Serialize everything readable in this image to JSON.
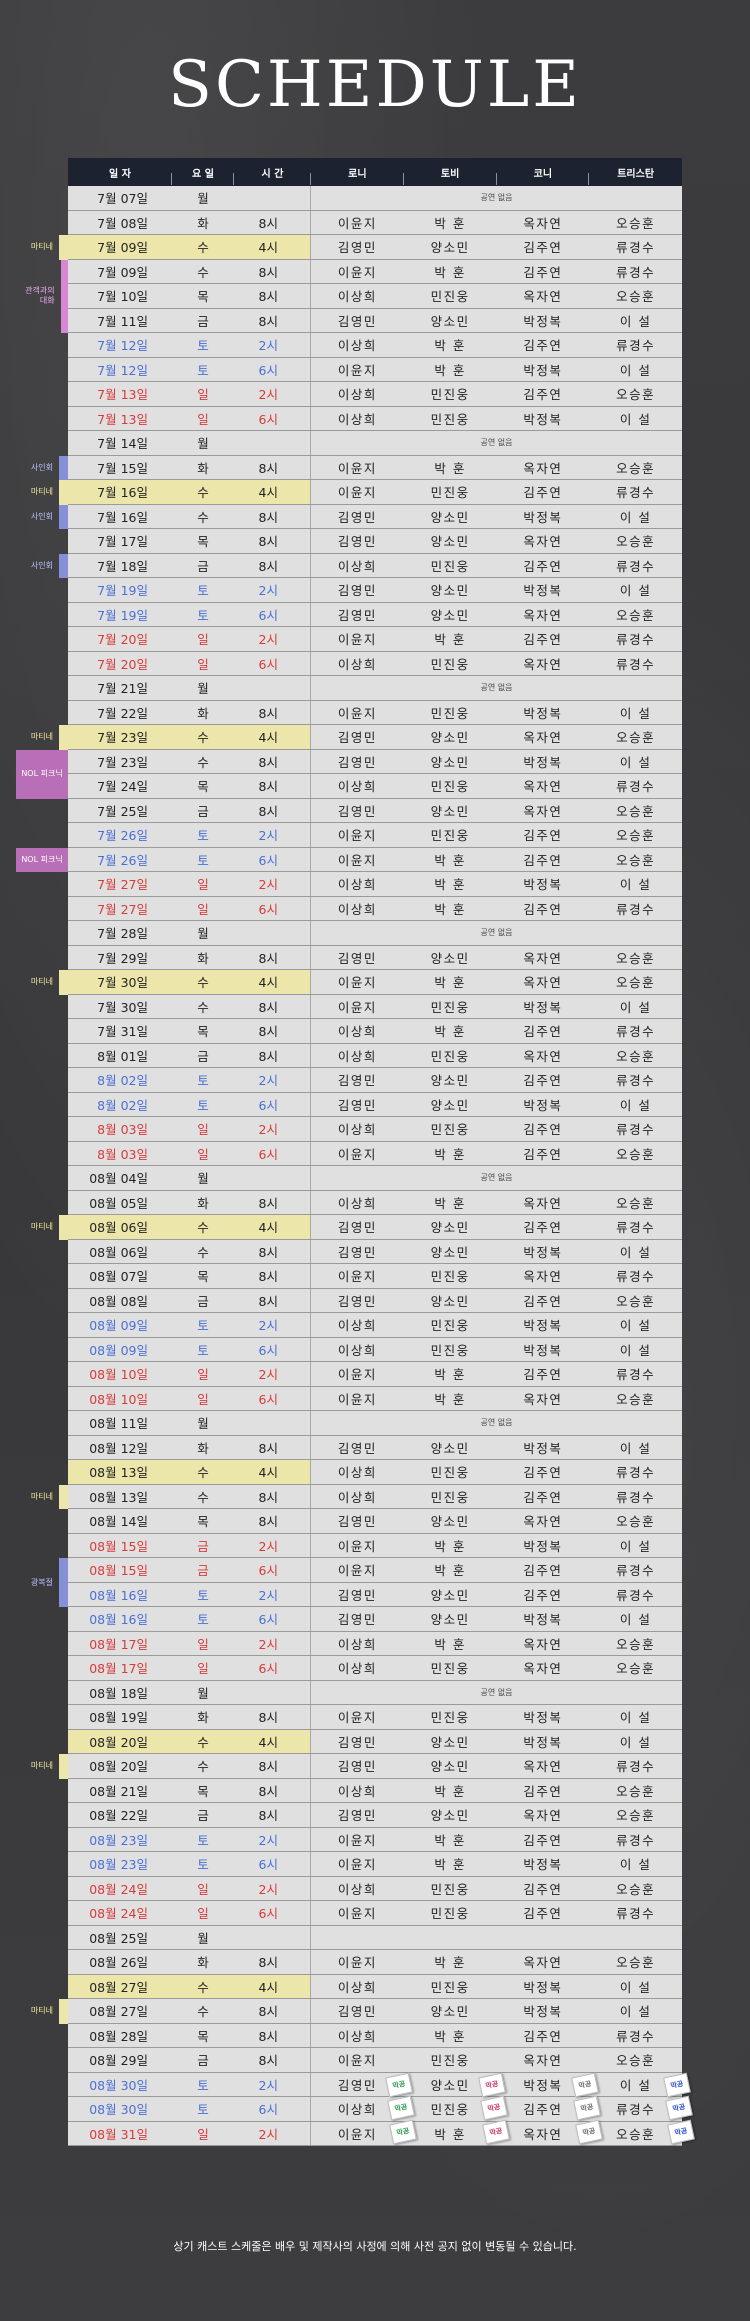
{
  "title": "SCHEDULE",
  "headers": [
    "일 자",
    "요 일",
    "시 간",
    "로니",
    "토비",
    "코니",
    "트리스탄"
  ],
  "no_show": "공연 없음",
  "rows": [
    {
      "date": "7월 07일",
      "day": "월",
      "time": "",
      "cast": [],
      "type": "off"
    },
    {
      "date": "7월 08일",
      "day": "화",
      "time": "8시",
      "cast": [
        "이윤지",
        "박 훈",
        "옥자연",
        "오승훈"
      ]
    },
    {
      "date": "7월 09일",
      "day": "수",
      "time": "4시",
      "cast": [
        "김영민",
        "양소민",
        "김주연",
        "류경수"
      ],
      "hl": true
    },
    {
      "date": "7월 09일",
      "day": "수",
      "time": "8시",
      "cast": [
        "이윤지",
        "박 훈",
        "김주연",
        "류경수"
      ]
    },
    {
      "date": "7월 10일",
      "day": "목",
      "time": "8시",
      "cast": [
        "이상희",
        "민진웅",
        "옥자연",
        "오승훈"
      ]
    },
    {
      "date": "7월 11일",
      "day": "금",
      "time": "8시",
      "cast": [
        "김영민",
        "양소민",
        "박정복",
        "이 설"
      ]
    },
    {
      "date": "7월 12일",
      "day": "토",
      "time": "2시",
      "cast": [
        "이상희",
        "박 훈",
        "김주연",
        "류경수"
      ],
      "type": "sat"
    },
    {
      "date": "7월 12일",
      "day": "토",
      "time": "6시",
      "cast": [
        "이윤지",
        "박 훈",
        "박정복",
        "이 설"
      ],
      "type": "sat"
    },
    {
      "date": "7월 13일",
      "day": "일",
      "time": "2시",
      "cast": [
        "이상희",
        "민진웅",
        "김주연",
        "오승훈"
      ],
      "type": "sun"
    },
    {
      "date": "7월 13일",
      "day": "일",
      "time": "6시",
      "cast": [
        "이상희",
        "민진웅",
        "박정복",
        "이 설"
      ],
      "type": "sun"
    },
    {
      "date": "7월 14일",
      "day": "월",
      "time": "",
      "cast": [],
      "type": "off"
    },
    {
      "date": "7월 15일",
      "day": "화",
      "time": "8시",
      "cast": [
        "이윤지",
        "박 훈",
        "옥자연",
        "오승훈"
      ]
    },
    {
      "date": "7월 16일",
      "day": "수",
      "time": "4시",
      "cast": [
        "이윤지",
        "민진웅",
        "김주연",
        "류경수"
      ],
      "hl": true
    },
    {
      "date": "7월 16일",
      "day": "수",
      "time": "8시",
      "cast": [
        "김영민",
        "양소민",
        "박정복",
        "이 설"
      ]
    },
    {
      "date": "7월 17일",
      "day": "목",
      "time": "8시",
      "cast": [
        "김영민",
        "양소민",
        "옥자연",
        "오승훈"
      ]
    },
    {
      "date": "7월 18일",
      "day": "금",
      "time": "8시",
      "cast": [
        "이상희",
        "민진웅",
        "김주연",
        "류경수"
      ]
    },
    {
      "date": "7월 19일",
      "day": "토",
      "time": "2시",
      "cast": [
        "김영민",
        "양소민",
        "박정복",
        "이 설"
      ],
      "type": "sat"
    },
    {
      "date": "7월 19일",
      "day": "토",
      "time": "6시",
      "cast": [
        "김영민",
        "양소민",
        "옥자연",
        "오승훈"
      ],
      "type": "sat"
    },
    {
      "date": "7월 20일",
      "day": "일",
      "time": "2시",
      "cast": [
        "이윤지",
        "박 훈",
        "김주연",
        "류경수"
      ],
      "type": "sun"
    },
    {
      "date": "7월 20일",
      "day": "일",
      "time": "6시",
      "cast": [
        "이상희",
        "민진웅",
        "옥자연",
        "류경수"
      ],
      "type": "sun"
    },
    {
      "date": "7월 21일",
      "day": "월",
      "time": "",
      "cast": [],
      "type": "off"
    },
    {
      "date": "7월 22일",
      "day": "화",
      "time": "8시",
      "cast": [
        "이윤지",
        "민진웅",
        "박정복",
        "이 설"
      ]
    },
    {
      "date": "7월 23일",
      "day": "수",
      "time": "4시",
      "cast": [
        "김영민",
        "양소민",
        "옥자연",
        "오승훈"
      ],
      "hl": true
    },
    {
      "date": "7월 23일",
      "day": "수",
      "time": "8시",
      "cast": [
        "김영민",
        "양소민",
        "박정복",
        "이 설"
      ]
    },
    {
      "date": "7월 24일",
      "day": "목",
      "time": "8시",
      "cast": [
        "이상희",
        "민진웅",
        "옥자연",
        "류경수"
      ]
    },
    {
      "date": "7월 25일",
      "day": "금",
      "time": "8시",
      "cast": [
        "김영민",
        "양소민",
        "옥자연",
        "오승훈"
      ]
    },
    {
      "date": "7월 26일",
      "day": "토",
      "time": "2시",
      "cast": [
        "이윤지",
        "민진웅",
        "김주연",
        "오승훈"
      ],
      "type": "sat"
    },
    {
      "date": "7월 26일",
      "day": "토",
      "time": "6시",
      "cast": [
        "이윤지",
        "박 훈",
        "김주연",
        "오승훈"
      ],
      "type": "sat"
    },
    {
      "date": "7월 27일",
      "day": "일",
      "time": "2시",
      "cast": [
        "이상희",
        "박 훈",
        "박정복",
        "이 설"
      ],
      "type": "sun"
    },
    {
      "date": "7월 27일",
      "day": "일",
      "time": "6시",
      "cast": [
        "이상희",
        "박 훈",
        "김주연",
        "류경수"
      ],
      "type": "sun"
    },
    {
      "date": "7월 28일",
      "day": "월",
      "time": "",
      "cast": [],
      "type": "off"
    },
    {
      "date": "7월 29일",
      "day": "화",
      "time": "8시",
      "cast": [
        "김영민",
        "양소민",
        "옥자연",
        "오승훈"
      ]
    },
    {
      "date": "7월 30일",
      "day": "수",
      "time": "4시",
      "cast": [
        "이윤지",
        "박 훈",
        "옥자연",
        "오승훈"
      ],
      "hl": true
    },
    {
      "date": "7월 30일",
      "day": "수",
      "time": "8시",
      "cast": [
        "이윤지",
        "민진웅",
        "박정복",
        "이 설"
      ]
    },
    {
      "date": "7월 31일",
      "day": "목",
      "time": "8시",
      "cast": [
        "이상희",
        "박 훈",
        "김주연",
        "류경수"
      ]
    },
    {
      "date": "8월 01일",
      "day": "금",
      "time": "8시",
      "cast": [
        "이상희",
        "민진웅",
        "옥자연",
        "오승훈"
      ]
    },
    {
      "date": "8월 02일",
      "day": "토",
      "time": "2시",
      "cast": [
        "김영민",
        "양소민",
        "김주연",
        "류경수"
      ],
      "type": "sat"
    },
    {
      "date": "8월 02일",
      "day": "토",
      "time": "6시",
      "cast": [
        "김영민",
        "양소민",
        "박정복",
        "이 설"
      ],
      "type": "sat"
    },
    {
      "date": "8월 03일",
      "day": "일",
      "time": "2시",
      "cast": [
        "이상희",
        "민진웅",
        "김주연",
        "류경수"
      ],
      "type": "sun"
    },
    {
      "date": "8월 03일",
      "day": "일",
      "time": "6시",
      "cast": [
        "이윤지",
        "박 훈",
        "김주연",
        "오승훈"
      ],
      "type": "sun"
    },
    {
      "date": "08월 04일",
      "day": "월",
      "time": "",
      "cast": [],
      "type": "off"
    },
    {
      "date": "08월 05일",
      "day": "화",
      "time": "8시",
      "cast": [
        "이상희",
        "박 훈",
        "옥자연",
        "오승훈"
      ]
    },
    {
      "date": "08월 06일",
      "day": "수",
      "time": "4시",
      "cast": [
        "김영민",
        "양소민",
        "김주연",
        "류경수"
      ],
      "hl": true
    },
    {
      "date": "08월 06일",
      "day": "수",
      "time": "8시",
      "cast": [
        "김영민",
        "양소민",
        "박정복",
        "이 설"
      ]
    },
    {
      "date": "08월 07일",
      "day": "목",
      "time": "8시",
      "cast": [
        "이윤지",
        "민진웅",
        "옥자연",
        "류경수"
      ]
    },
    {
      "date": "08월 08일",
      "day": "금",
      "time": "8시",
      "cast": [
        "김영민",
        "양소민",
        "김주연",
        "오승훈"
      ]
    },
    {
      "date": "08월 09일",
      "day": "토",
      "time": "2시",
      "cast": [
        "이상희",
        "민진웅",
        "박정복",
        "이 설"
      ],
      "type": "sat"
    },
    {
      "date": "08월 09일",
      "day": "토",
      "time": "6시",
      "cast": [
        "이상희",
        "민진웅",
        "박정복",
        "이 설"
      ],
      "type": "sat"
    },
    {
      "date": "08월 10일",
      "day": "일",
      "time": "2시",
      "cast": [
        "이윤지",
        "박 훈",
        "김주연",
        "류경수"
      ],
      "type": "sun"
    },
    {
      "date": "08월 10일",
      "day": "일",
      "time": "6시",
      "cast": [
        "이윤지",
        "박 훈",
        "옥자연",
        "오승훈"
      ],
      "type": "sun"
    },
    {
      "date": "08월 11일",
      "day": "월",
      "time": "",
      "cast": [],
      "type": "off"
    },
    {
      "date": "08월 12일",
      "day": "화",
      "time": "8시",
      "cast": [
        "김영민",
        "양소민",
        "박정복",
        "이 설"
      ]
    },
    {
      "date": "08월 13일",
      "day": "수",
      "time": "4시",
      "cast": [
        "이상희",
        "민진웅",
        "김주연",
        "류경수"
      ],
      "hl": true
    },
    {
      "date": "08월 13일",
      "day": "수",
      "time": "8시",
      "cast": [
        "이상희",
        "민진웅",
        "김주연",
        "류경수"
      ]
    },
    {
      "date": "08월 14일",
      "day": "목",
      "time": "8시",
      "cast": [
        "김영민",
        "양소민",
        "옥자연",
        "오승훈"
      ]
    },
    {
      "date": "08월 15일",
      "day": "금",
      "time": "2시",
      "cast": [
        "이윤지",
        "박 훈",
        "박정복",
        "이 설"
      ],
      "type": "sun"
    },
    {
      "date": "08월 15일",
      "day": "금",
      "time": "6시",
      "cast": [
        "이윤지",
        "박 훈",
        "김주연",
        "류경수"
      ],
      "type": "sun"
    },
    {
      "date": "08월 16일",
      "day": "토",
      "time": "2시",
      "cast": [
        "김영민",
        "양소민",
        "김주연",
        "류경수"
      ],
      "type": "sat"
    },
    {
      "date": "08월 16일",
      "day": "토",
      "time": "6시",
      "cast": [
        "김영민",
        "양소민",
        "박정복",
        "이 설"
      ],
      "type": "sat"
    },
    {
      "date": "08월 17일",
      "day": "일",
      "time": "2시",
      "cast": [
        "이상희",
        "박 훈",
        "옥자연",
        "오승훈"
      ],
      "type": "sun"
    },
    {
      "date": "08월 17일",
      "day": "일",
      "time": "6시",
      "cast": [
        "이상희",
        "민진웅",
        "옥자연",
        "오승훈"
      ],
      "type": "sun"
    },
    {
      "date": "08월 18일",
      "day": "월",
      "time": "",
      "cast": [],
      "type": "off"
    },
    {
      "date": "08월 19일",
      "day": "화",
      "time": "8시",
      "cast": [
        "이윤지",
        "민진웅",
        "박정복",
        "이 설"
      ]
    },
    {
      "date": "08월 20일",
      "day": "수",
      "time": "4시",
      "cast": [
        "김영민",
        "양소민",
        "박정복",
        "이 설"
      ],
      "hl": true
    },
    {
      "date": "08월 20일",
      "day": "수",
      "time": "8시",
      "cast": [
        "김영민",
        "양소민",
        "옥자연",
        "류경수"
      ]
    },
    {
      "date": "08월 21일",
      "day": "목",
      "time": "8시",
      "cast": [
        "이상희",
        "박 훈",
        "김주연",
        "오승훈"
      ]
    },
    {
      "date": "08월 22일",
      "day": "금",
      "time": "8시",
      "cast": [
        "김영민",
        "양소민",
        "옥자연",
        "오승훈"
      ]
    },
    {
      "date": "08월 23일",
      "day": "토",
      "time": "2시",
      "cast": [
        "이윤지",
        "박 훈",
        "김주연",
        "류경수"
      ],
      "type": "sat"
    },
    {
      "date": "08월 23일",
      "day": "토",
      "time": "6시",
      "cast": [
        "이윤지",
        "박 훈",
        "박정복",
        "이 설"
      ],
      "type": "sat"
    },
    {
      "date": "08월 24일",
      "day": "일",
      "time": "2시",
      "cast": [
        "이상희",
        "민진웅",
        "김주연",
        "오승훈"
      ],
      "type": "sun"
    },
    {
      "date": "08월 24일",
      "day": "일",
      "time": "6시",
      "cast": [
        "이윤지",
        "민진웅",
        "김주연",
        "류경수"
      ],
      "type": "sun"
    },
    {
      "date": "08월 25일",
      "day": "월",
      "time": "",
      "cast": [],
      "type": "empty"
    },
    {
      "date": "08월 26일",
      "day": "화",
      "time": "8시",
      "cast": [
        "이윤지",
        "박 훈",
        "옥자연",
        "오승훈"
      ]
    },
    {
      "date": "08월 27일",
      "day": "수",
      "time": "4시",
      "cast": [
        "이상희",
        "민진웅",
        "박정복",
        "이 설"
      ],
      "hl": true
    },
    {
      "date": "08월 27일",
      "day": "수",
      "time": "8시",
      "cast": [
        "김영민",
        "양소민",
        "박정복",
        "이 설"
      ]
    },
    {
      "date": "08월 28일",
      "day": "목",
      "time": "8시",
      "cast": [
        "이상희",
        "박 훈",
        "김주연",
        "류경수"
      ]
    },
    {
      "date": "08월 29일",
      "day": "금",
      "time": "8시",
      "cast": [
        "이윤지",
        "민진웅",
        "옥자연",
        "오승훈"
      ]
    },
    {
      "date": "08월 30일",
      "day": "토",
      "time": "2시",
      "cast": [
        "김영민",
        "양소민",
        "박정복",
        "이 설"
      ],
      "type": "sat"
    },
    {
      "date": "08월 30일",
      "day": "토",
      "time": "6시",
      "cast": [
        "이상희",
        "민진웅",
        "김주연",
        "류경수"
      ],
      "type": "sat"
    },
    {
      "date": "08월 31일",
      "day": "일",
      "time": "2시",
      "cast": [
        "이윤지",
        "박 훈",
        "옥자연",
        "오승훈"
      ],
      "type": "sun"
    }
  ],
  "side_tags": [
    {
      "label": "마티네",
      "row": 2,
      "span": 1,
      "style": "yellow"
    },
    {
      "label": "관객과의 대화",
      "row": 3,
      "span": 3,
      "style": "pink"
    },
    {
      "label": "사인회",
      "row": 11,
      "span": 1,
      "style": "blue"
    },
    {
      "label": "마티네",
      "row": 12,
      "span": 1,
      "style": "yellow"
    },
    {
      "label": "사인회",
      "row": 13,
      "span": 1,
      "style": "blue"
    },
    {
      "label": "사인회",
      "row": 15,
      "span": 1,
      "style": "blue"
    },
    {
      "label": "마티네",
      "row": 22,
      "span": 1,
      "style": "yellow"
    },
    {
      "label": "NOL 피크닉",
      "row": 23,
      "span": 2,
      "style": "purple-fill"
    },
    {
      "label": "NOL 피크닉",
      "row": 27,
      "span": 1,
      "style": "purple-fill"
    },
    {
      "label": "마티네",
      "row": 32,
      "span": 1,
      "style": "yellow"
    },
    {
      "label": "마티네",
      "row": 42,
      "span": 1,
      "style": "yellow"
    },
    {
      "label": "마티네",
      "row": 53,
      "span": 1,
      "style": "yellow"
    },
    {
      "label": "광복절",
      "row": 56,
      "span": 2,
      "style": "blue"
    },
    {
      "label": "마티네",
      "row": 64,
      "span": 1,
      "style": "yellow"
    },
    {
      "label": "마티네",
      "row": 74,
      "span": 1,
      "style": "yellow"
    }
  ],
  "stamp_label": "막공",
  "stamp_colors": [
    "#2a9a4a",
    "#d0306a",
    "#6b6b6b",
    "#2a4fd0"
  ],
  "footer": "상기 캐스트 스케줄은 배우 및 제작사의 사정에 의해 사전 공지 없이 변동될 수 있습니다."
}
